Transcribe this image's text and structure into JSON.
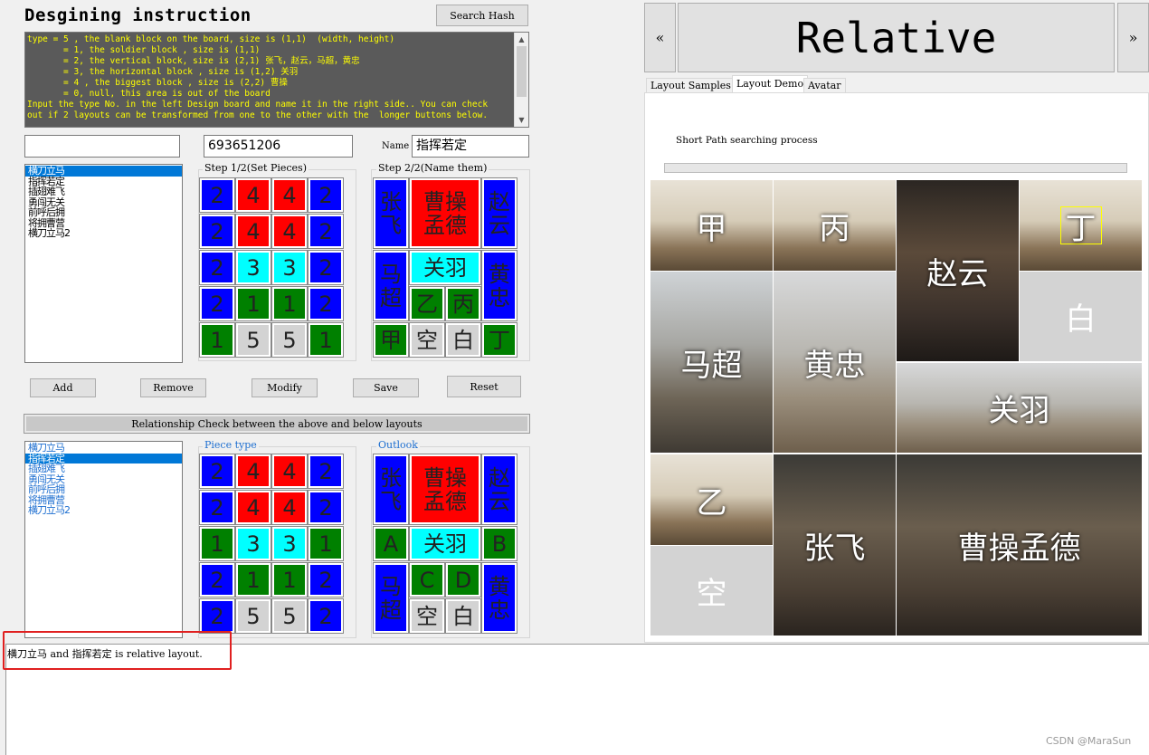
{
  "title": "Desgining instruction",
  "search_hash_label": "Search Hash",
  "instructions": [
    "type = 5 , the blank block on the board, size is (1,1)  (width, height)",
    "       = 1, the soldier block , size is (1,1)",
    "       = 2, the vertical block, size is (2,1) 张飞，赵云，马超，黄忠",
    "       = 3, the horizontal block , size is (1,2) 关羽",
    "       = 4 , the biggest block , size is (2,2) 曹操",
    "       = 0, null, this area is out of the board",
    "Input the type No. in the left Design board and name it in the right side.. You can check",
    "out if 2 layouts can be transformed from one to the other with the  longer buttons below."
  ],
  "search_input_value": "",
  "hash_input_value": "693651206",
  "name_label": "Name",
  "name_input_value": "指挥若定",
  "layout_list_top": [
    "横刀立马",
    "指挥若定",
    "插翅难飞",
    "勇闯无关",
    "前呼后拥",
    "将拥曹营",
    "横刀立马2"
  ],
  "layout_list_top_selected": 0,
  "step1_label": "Step 1/2(Set Pieces)",
  "step2_label": "Step 2/2(Name them)",
  "grid_top": [
    [
      "2",
      "4",
      "4",
      "2"
    ],
    [
      "2",
      "4",
      "4",
      "2"
    ],
    [
      "2",
      "3",
      "3",
      "2"
    ],
    [
      "2",
      "1",
      "1",
      "2"
    ],
    [
      "1",
      "5",
      "5",
      "1"
    ]
  ],
  "named_top": {
    "zhangfei": "张飞",
    "caocao": "曹操孟德",
    "zhaoyun": "赵云",
    "machao": "马超",
    "guanyu": "关羽",
    "huangzhong": "黄忠",
    "yi": "乙",
    "bing": "丙",
    "jia": "甲",
    "kong": "空",
    "bai": "白",
    "ding": "丁"
  },
  "buttons": {
    "add": "Add",
    "remove": "Remove",
    "modify": "Modify",
    "save": "Save",
    "reset": "Reset"
  },
  "relationship_label": "Relationship Check between the above and below layouts",
  "layout_list_bottom": [
    "横刀立马",
    "指挥若定",
    "插翅难飞",
    "勇闯无关",
    "前呼后拥",
    "将拥曹营",
    "横刀立马2"
  ],
  "layout_list_bottom_selected": 1,
  "piece_type_label": "Piece type",
  "outlook_label": "Outlook",
  "grid_bottom": [
    [
      "2",
      "4",
      "4",
      "2"
    ],
    [
      "2",
      "4",
      "4",
      "2"
    ],
    [
      "1",
      "3",
      "3",
      "1"
    ],
    [
      "2",
      "1",
      "1",
      "2"
    ],
    [
      "2",
      "5",
      "5",
      "2"
    ]
  ],
  "named_bottom": {
    "zhangfei": "张飞",
    "caocao": "曹操孟德",
    "zhaoyun": "赵云",
    "a": "A",
    "guanyu": "关羽",
    "b": "B",
    "machao": "马超",
    "c": "C",
    "d": "D",
    "huangzhong": "黄忠",
    "kong": "空",
    "bai": "白"
  },
  "result_text": "横刀立马 and 指挥若定 is relative layout.",
  "nav_prev": "«",
  "nav_next": "»",
  "relative_title": "Relative",
  "tabs": [
    "Layout Samples",
    "Layout Demo",
    "Avatar"
  ],
  "active_tab": 1,
  "short_path_label": "Short Path searching process",
  "progress_fraction": 0,
  "demo_tiles": {
    "jia": "甲",
    "bing": "丙",
    "zhaoyun": "赵云",
    "ding": "丁",
    "bai": "白",
    "machao": "马超",
    "huangzhong": "黄忠",
    "guanyu": "关羽",
    "yi": "乙",
    "zhangfei": "张飞",
    "caocao": "曹操孟德",
    "kong": "空"
  },
  "watermark": "CSDN @MaraSun",
  "colors": {
    "type1": "#008000",
    "type2": "#0000ff",
    "type3": "#00ffff",
    "type4": "#ff0000",
    "type5": "#d3d3d3",
    "highlight": "#e02020"
  }
}
